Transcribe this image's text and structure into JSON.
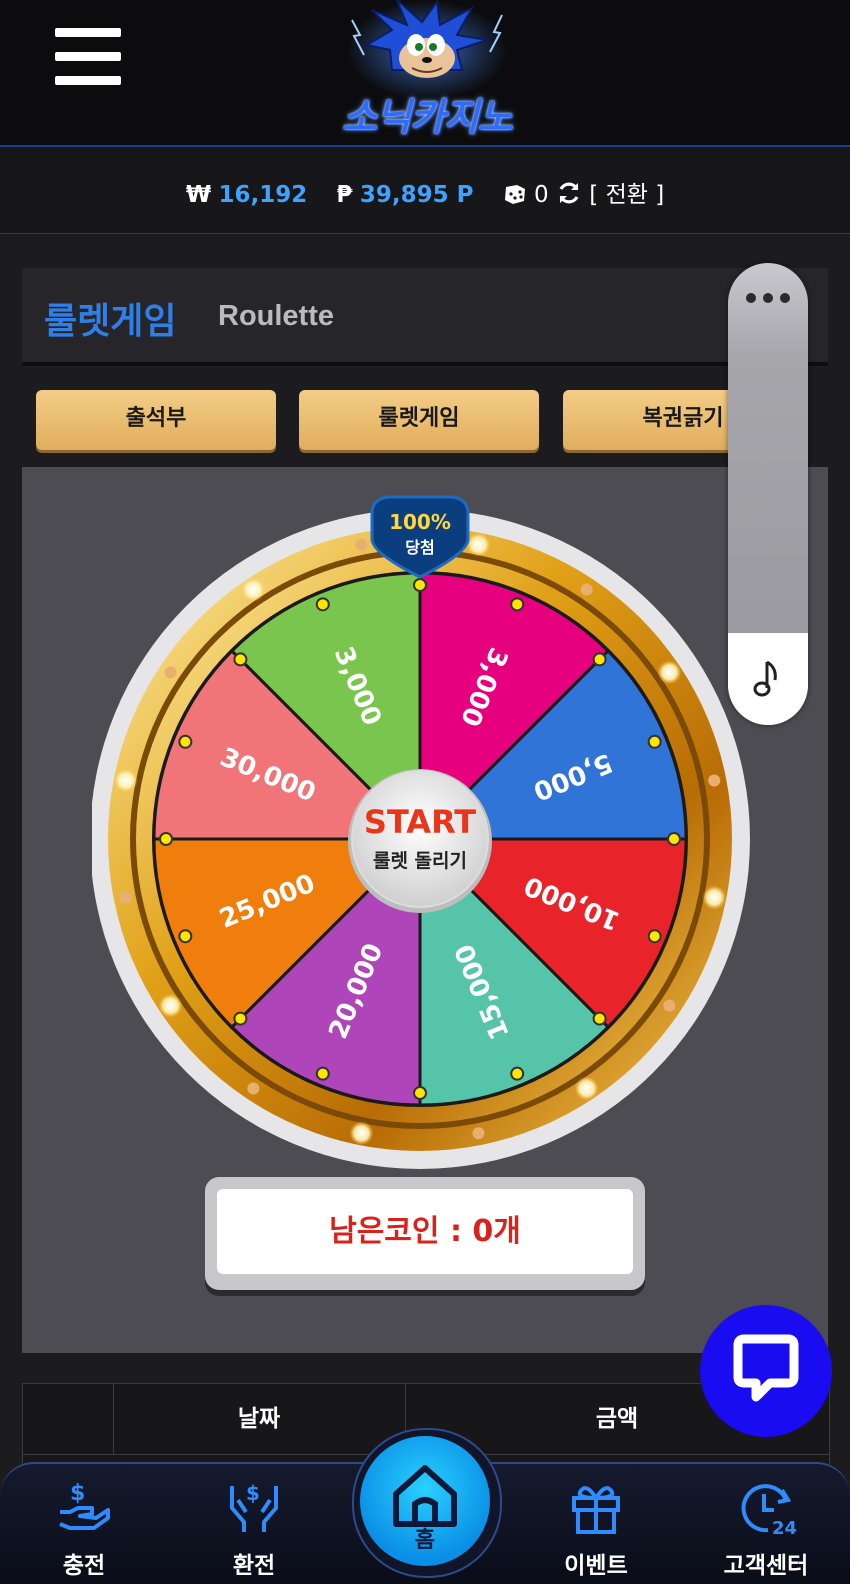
{
  "header": {
    "logo_text": "소닉카지노",
    "menu_icon": "hamburger-icon"
  },
  "balance": {
    "won_symbol": "₩",
    "won_amount": "16,192",
    "point_symbol": "₱",
    "point_amount": "39,895 P",
    "dice_count": "0",
    "switch_label": "[ 전환 ]"
  },
  "page": {
    "title_ko": "룰렛게임",
    "title_en": "Roulette"
  },
  "tabs": [
    {
      "label": "출석부"
    },
    {
      "label": "룰렛게임"
    },
    {
      "label": "복권긁기"
    }
  ],
  "wheel": {
    "badge_top": "100%",
    "badge_bottom": "당첨",
    "start_label": "START",
    "start_sub": "룰렛 돌리기",
    "segments": [
      {
        "label": "3,000",
        "color": "#e6007e"
      },
      {
        "label": "5,000",
        "color": "#2f74d6"
      },
      {
        "label": "10,000",
        "color": "#e8242a"
      },
      {
        "label": "15,000",
        "color": "#56c4a8"
      },
      {
        "label": "20,000",
        "color": "#ae45b8"
      },
      {
        "label": "25,000",
        "color": "#f07e0c"
      },
      {
        "label": "30,000",
        "color": "#f07478"
      },
      {
        "label": "3,000",
        "color": "#79c54e"
      }
    ]
  },
  "coins": {
    "text": "남은코인 : 0개"
  },
  "table": {
    "headers": [
      "",
      "날짜",
      "금액"
    ]
  },
  "nav": {
    "items": [
      {
        "label": "충전",
        "icon": "deposit-icon"
      },
      {
        "label": "환전",
        "icon": "exchange-icon"
      },
      {
        "label": "홈",
        "icon": "home-icon"
      },
      {
        "label": "이벤트",
        "icon": "gift-icon"
      },
      {
        "label": "고객센터",
        "icon": "support-24-icon"
      }
    ]
  },
  "colors": {
    "accent_blue": "#2f7fe8",
    "balance_blue": "#3ea2ff",
    "tab_gold": "#e1ad5d",
    "chat_blue": "#1a0cf0",
    "coin_red": "#d8231b"
  }
}
